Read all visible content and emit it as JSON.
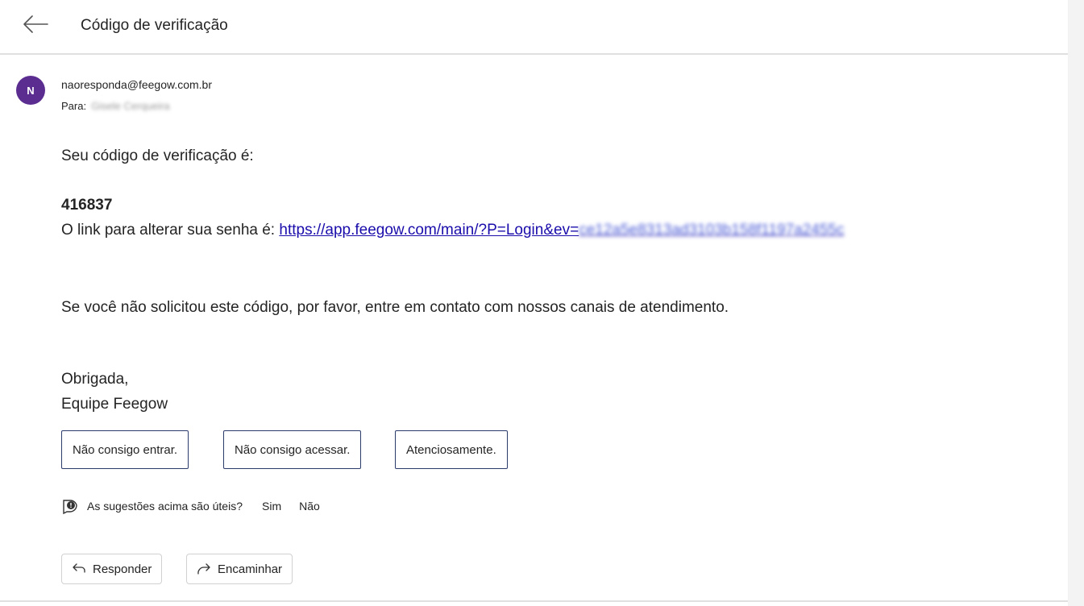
{
  "header": {
    "back_icon": "arrow-left-icon",
    "subject": "Código de verificação"
  },
  "message": {
    "avatar_initial": "N",
    "avatar_color": "#5b2d91",
    "from": "naoresponda@feegow.com.br",
    "to_label": "Para:",
    "to_name": "Gisele Cerqueira",
    "body": {
      "intro": "Seu código de verificação é:",
      "code": "416837",
      "link_prefix": "O link para alterar sua senha é: ",
      "link_visible": "https://app.feegow.com/main/?P=Login&ev=",
      "link_blurred": "ce12a5e8313ad3103b158f1197a2455c",
      "disclaimer": "Se você não solicitou este código, por favor, entre em contato com nossos canais de atendimento.",
      "signoff": "Obrigada,",
      "signature": "Equipe Feegow"
    }
  },
  "suggestions": [
    "Não consigo entrar.",
    "Não consigo acessar.",
    "Atenciosamente."
  ],
  "feedback": {
    "icon": "feedback-icon",
    "question": "As sugestões acima são úteis?",
    "yes": "Sim",
    "no": "Não"
  },
  "actions": {
    "reply_icon": "reply-icon",
    "reply": "Responder",
    "forward_icon": "forward-icon",
    "forward": "Encaminhar"
  },
  "colors": {
    "link": "#1a0dab",
    "suggestion_border": "#2b3c6b",
    "divider": "#e0e0e0"
  }
}
